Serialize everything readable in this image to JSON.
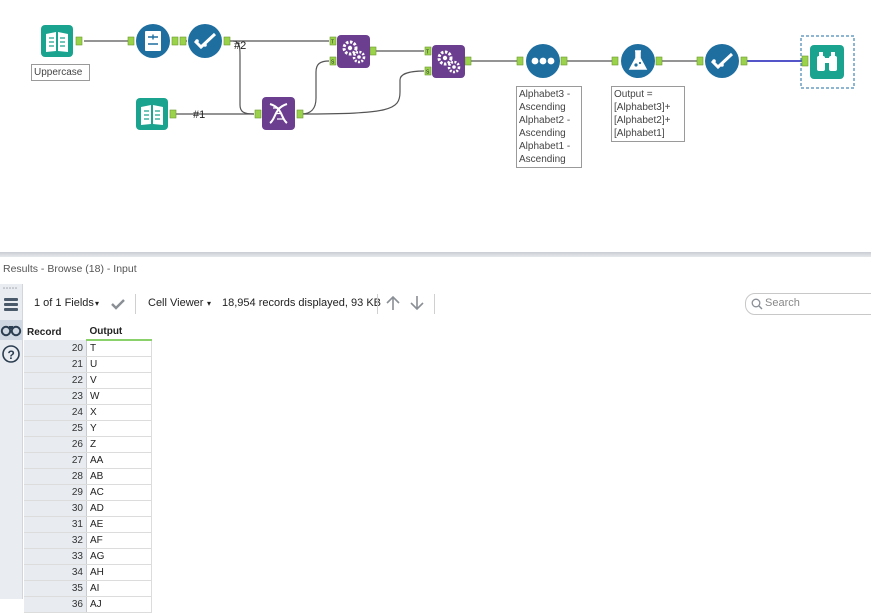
{
  "canvas": {
    "annotations": {
      "uppercase": "Uppercase",
      "sort_lines": [
        "Alphabet3 -",
        "Ascending",
        "Alphabet2 -",
        "Ascending",
        "Alphabet1 -",
        "Ascending"
      ],
      "formula_lines": [
        "Output =",
        "[Alphabet3]+",
        "[Alphabet2]+",
        "[Alphabet1]"
      ]
    },
    "wire_labels": {
      "top": "#2",
      "bottom": "#1"
    },
    "tools": [
      {
        "name": "input-data-tool-1",
        "icon": "book-icon",
        "color": "#1aa48f"
      },
      {
        "name": "generate-rows-tool",
        "icon": "form-icon",
        "color": "#1e6ea0"
      },
      {
        "name": "select-tool-1",
        "icon": "check-icon",
        "color": "#1e6ea0"
      },
      {
        "name": "input-data-tool-2",
        "icon": "book-icon",
        "color": "#1aa48f"
      },
      {
        "name": "append-fields-tool",
        "icon": "dna-icon",
        "color": "#6b3e8f"
      },
      {
        "name": "batch-macro-tool-1",
        "icon": "gears-icon",
        "color": "#6b3e8f"
      },
      {
        "name": "batch-macro-tool-2",
        "icon": "gears-icon",
        "color": "#6b3e8f"
      },
      {
        "name": "sort-tool",
        "icon": "dots-icon",
        "color": "#1e6ea0"
      },
      {
        "name": "formula-tool",
        "icon": "flask-icon",
        "color": "#1e6ea0"
      },
      {
        "name": "select-tool-2",
        "icon": "check-icon",
        "color": "#1e6ea0"
      },
      {
        "name": "browse-tool",
        "icon": "binoculars-icon",
        "color": "#1aa48f"
      }
    ]
  },
  "results": {
    "title": "Results - Browse (18) - Input",
    "fields_label": "1 of 1 Fields",
    "viewer_label": "Cell Viewer",
    "records_info": "18,954 records displayed, 93 KB",
    "search_placeholder": "Search"
  },
  "table": {
    "headers": [
      "Record",
      "Output"
    ],
    "rows": [
      {
        "record": "20",
        "output": "T"
      },
      {
        "record": "21",
        "output": "U"
      },
      {
        "record": "22",
        "output": "V"
      },
      {
        "record": "23",
        "output": "W"
      },
      {
        "record": "24",
        "output": "X"
      },
      {
        "record": "25",
        "output": "Y"
      },
      {
        "record": "26",
        "output": "Z"
      },
      {
        "record": "27",
        "output": "AA"
      },
      {
        "record": "28",
        "output": "AB"
      },
      {
        "record": "29",
        "output": "AC"
      },
      {
        "record": "30",
        "output": "AD"
      },
      {
        "record": "31",
        "output": "AE"
      },
      {
        "record": "32",
        "output": "AF"
      },
      {
        "record": "33",
        "output": "AG"
      },
      {
        "record": "34",
        "output": "AH"
      },
      {
        "record": "35",
        "output": "AI"
      },
      {
        "record": "36",
        "output": "AJ"
      }
    ]
  },
  "colors": {
    "anchor": "#9bd24b",
    "wire": "#555555",
    "selected_wire": "#1d1db8"
  }
}
